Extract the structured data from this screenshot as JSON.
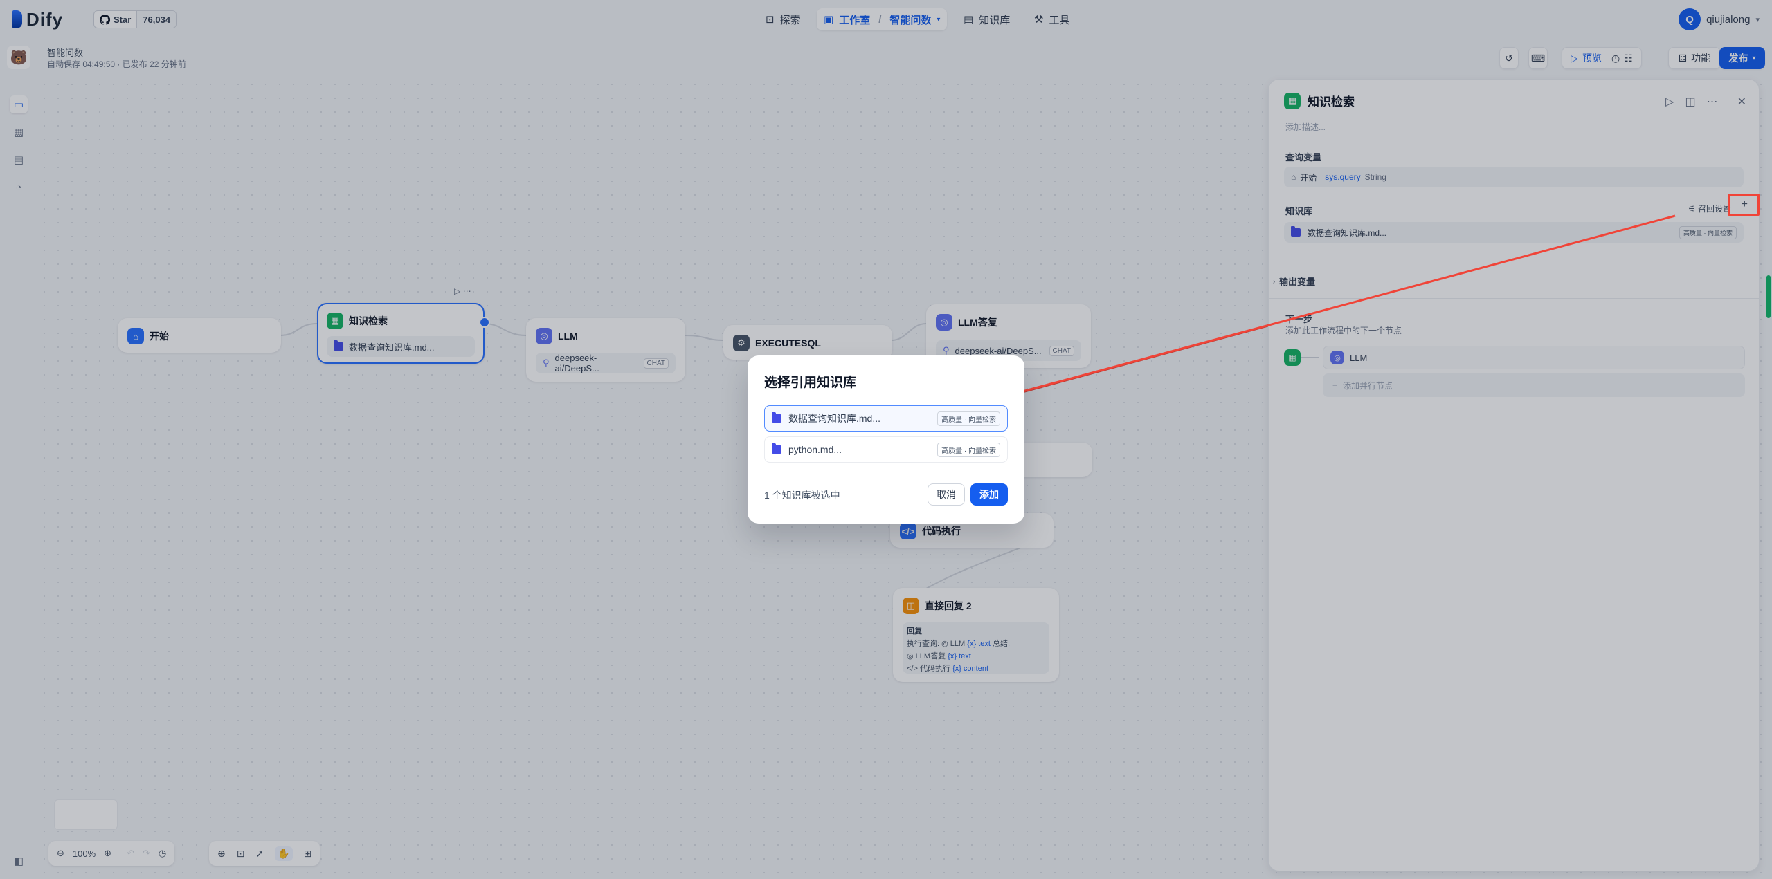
{
  "header": {
    "logo_text": "Dify",
    "github": {
      "label": "Star",
      "count": "76,034"
    },
    "nav": [
      {
        "label": "探索",
        "icon": "compass-icon"
      },
      {
        "label": "工作室",
        "sub": "智能问数",
        "icon": "studio-icon"
      },
      {
        "label": "知识库",
        "icon": "book-icon"
      },
      {
        "label": "工具",
        "icon": "tools-icon"
      }
    ],
    "user": {
      "initial": "Q",
      "name": "qiujialong"
    }
  },
  "app": {
    "name": "智能问数",
    "save_status": "自动保存 04:49:50 · 已发布 22 分钟前"
  },
  "toolbar": {
    "preview_label": "预览",
    "features_label": "功能",
    "publish_label": "发布"
  },
  "nodes": {
    "start": {
      "title": "开始"
    },
    "kr": {
      "title": "知识检索",
      "body": "数据查询知识库.md..."
    },
    "llm": {
      "title": "LLM",
      "model": "deepseek-ai/DeepS...",
      "chip": "CHAT"
    },
    "exec": {
      "title": "EXECUTESQL"
    },
    "llm_reply": {
      "title": "LLM答复",
      "model": "deepseek-ai/DeepS...",
      "chip": "CHAT"
    },
    "code": {
      "title": "代码执行"
    },
    "direct": {
      "title": "直接回复 2",
      "label": "回复",
      "line1_prefix": "执行查询:",
      "line1_node": "LLM",
      "line1_var": "{x} text",
      "line1_suffix": "总结:",
      "line2_node": "LLM答复",
      "line2_var": "{x} text",
      "line3_node": "代码执行",
      "line3_var": "{x} content"
    }
  },
  "panel": {
    "title": "知识检索",
    "desc_placeholder": "添加描述...",
    "query_label": "查询变量",
    "query_node": "开始",
    "query_var": "sys.query",
    "query_type": "String",
    "kb_label": "知识库",
    "recall_label": "召回设置",
    "kb_item": "数据查询知识库.md...",
    "kb_badge": "高质量 · 向量检索",
    "output_label": "输出变量",
    "next_label": "下一步",
    "next_desc": "添加此工作流程中的下一个节点",
    "next_node": "LLM",
    "add_parallel": "添加并行节点"
  },
  "modal": {
    "title": "选择引用知识库",
    "items": [
      {
        "name": "数据查询知识库.md...",
        "badge": "高质量 · 向量检索",
        "selected": true
      },
      {
        "name": "python.md...",
        "badge": "高质量 · 向量检索",
        "selected": false
      }
    ],
    "selected_count": "1 个知识库被选中",
    "cancel": "取消",
    "add": "添加"
  },
  "bottom": {
    "zoom": "100%"
  },
  "colors": {
    "primary": "#155eef",
    "highlight": "#f04438",
    "node_green": "#16b364",
    "node_blue": "#2970ff"
  }
}
